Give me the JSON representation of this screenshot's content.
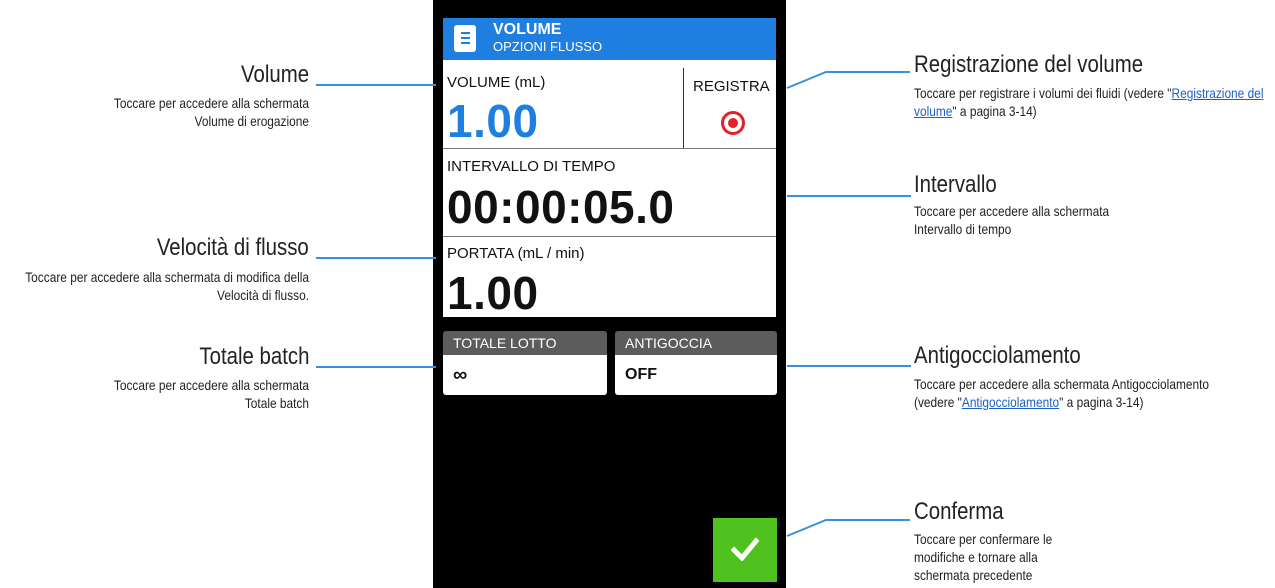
{
  "screen": {
    "header": {
      "title": "VOLUME",
      "subtitle": "OPZIONI FLUSSO"
    },
    "volume": {
      "label": "VOLUME (mL)",
      "value": "1.00"
    },
    "registra": {
      "label": "REGISTRA"
    },
    "intervallo": {
      "label": "INTERVALLO DI TEMPO",
      "value": "00:00:05.0"
    },
    "portata": {
      "label": "PORTATA (mL / min)",
      "value": "1.00"
    },
    "totale_lotto": {
      "label": "TOTALE LOTTO",
      "value": "∞"
    },
    "antigoccia": {
      "label": "ANTIGOCCIA",
      "value": "OFF"
    },
    "confirm_icon": "check-icon"
  },
  "callouts": {
    "volume": {
      "title": "Volume",
      "desc": "Toccare per accedere alla schermata Volume di erogazione"
    },
    "velocita": {
      "title": "Velocità di flusso",
      "desc": "Toccare per accedere alla schermata di modifica della Velocità di flusso."
    },
    "totale": {
      "title": "Totale batch",
      "desc": "Toccare per accedere alla schermata Totale batch"
    },
    "registrazione": {
      "title": "Registrazione del volume",
      "desc_pre": "Toccare per registrare i volumi dei fluidi (vedere \"",
      "link": "Registrazione del volume",
      "desc_post": "\" a pagina 3-14)"
    },
    "intervallo": {
      "title": "Intervallo",
      "desc": "Toccare per accedere alla schermata Intervallo di tempo"
    },
    "antigocciolamento": {
      "title": "Antigocciolamento",
      "desc_pre": "Toccare per accedere alla schermata Antigocciolamento (vedere \"",
      "link": "Antigocciolamento",
      "desc_post": "\" a pagina 3-14)"
    },
    "conferma": {
      "title": "Conferma",
      "desc": "Toccare per confermare le modifiche e tornare alla schermata precedente"
    }
  },
  "colors": {
    "header_blue": "#1f7fe0",
    "volume_blue": "#1f7fe0",
    "record_red": "#e5202a",
    "confirm_green": "#4fc21f",
    "leader_blue": "#3a8fe0"
  }
}
